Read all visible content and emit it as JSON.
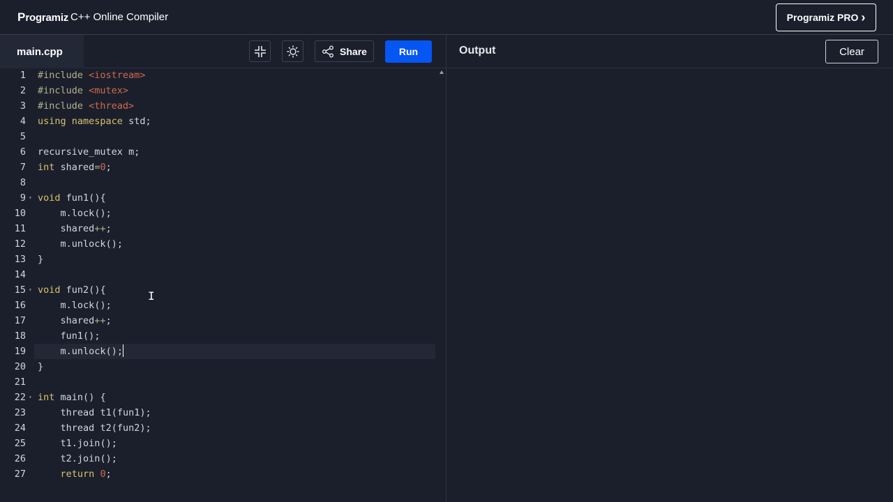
{
  "header": {
    "logo_text": "rogramiz",
    "logo_mark": "P",
    "app_title": "C++ Online Compiler",
    "pro_button": "Programiz PRO",
    "pro_chevron": "›"
  },
  "toolbar": {
    "file_tab": "main.cpp",
    "share_label": "Share",
    "run_label": "Run"
  },
  "output": {
    "title": "Output",
    "clear_label": "Clear",
    "text": ""
  },
  "editor": {
    "active_line": 19,
    "lines": [
      "#include <iostream>",
      "#include <mutex>",
      "#include <thread>",
      "using namespace std;",
      "",
      "recursive_mutex m;",
      "int shared=0;",
      "",
      "void fun1(){",
      "    m.lock();",
      "    shared++;",
      "    m.unlock();",
      "}",
      "",
      "void fun2(){",
      "    m.lock();",
      "    shared++;",
      "    fun1();",
      "    m.unlock();",
      "}",
      "",
      "int main() {",
      "    thread t1(fun1);",
      "    thread t2(fun2);",
      "    t1.join();",
      "    t2.join();",
      "    return 0;"
    ],
    "fold_lines": [
      9,
      15,
      22
    ]
  },
  "colors": {
    "accent_run": "#0556f3",
    "background": "#1b1f2c",
    "string": "#cf6a4c",
    "keyword": "#d8c26a"
  }
}
